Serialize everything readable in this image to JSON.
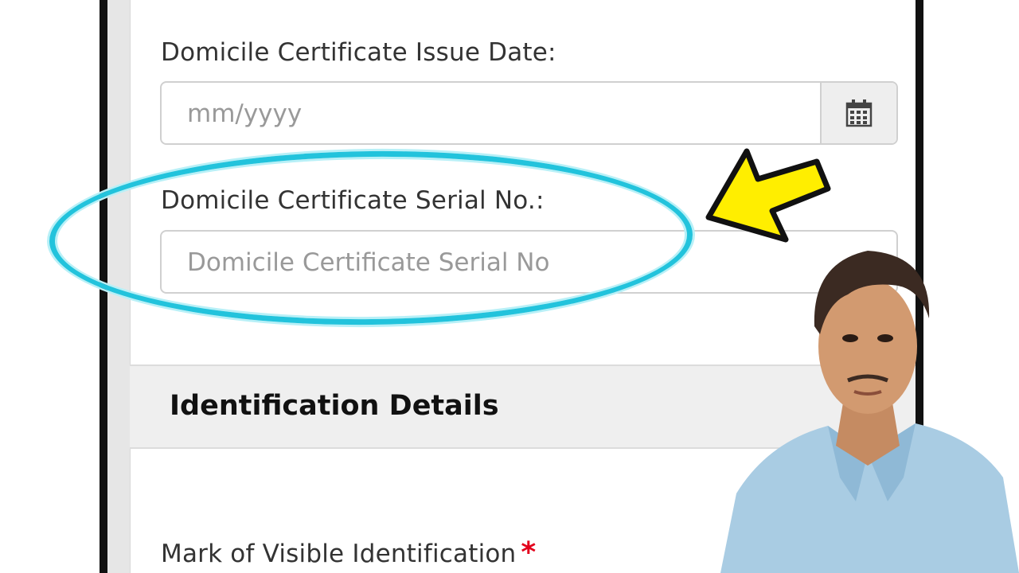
{
  "form": {
    "issue_date_label": "Domicile Certificate Issue Date:",
    "issue_date_placeholder": "mm/yyyy",
    "serial_label": "Domicile Certificate Serial No.:",
    "serial_placeholder": "Domicile Certificate Serial No"
  },
  "section": {
    "title": "Identification Details"
  },
  "mark_field": {
    "label": "Mark of Visible Identification",
    "required_marker": "*"
  },
  "icons": {
    "calendar": "calendar-icon",
    "arrow": "arrow-icon"
  },
  "colors": {
    "highlight_oval": "#22c3dc",
    "arrow": "#ffee00",
    "required": "#e3001b"
  }
}
